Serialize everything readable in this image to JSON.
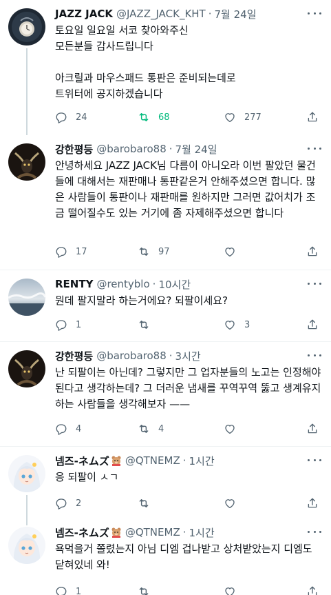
{
  "tweets": [
    {
      "name": "JAZZ JACK",
      "handle": "@JAZZ_JACK_KHT",
      "dot": "·",
      "time": "7월 24일",
      "text": "토요일 일요일 서코 찾아와주신\n모든분들 감사드립니다\n\n아크릴과 마우스패드 통판은 준비되는데로\n트위터에 공지하겠습니다",
      "reply_count": "24",
      "retweet_count": "68",
      "like_count": "277",
      "retweeted": true,
      "avatar": "dark-clock-icon"
    },
    {
      "name": "강한평등",
      "handle": "@barobaro88",
      "dot": "·",
      "time": "7월 24일",
      "text": "안녕하세요 JAZZ JACK님 다름이 아니오라 이번 팔았던 물건들에 대해서는 재판매나 통판같은거 안해주셨으면 합니다. 많은 사람들이 통판이나 재판매를 원하지만 그러면 값어치가 조금 떨어질수도 있는 거기에 좀 자제해주셨으면 합니다",
      "reply_count": "17",
      "retweet_count": "97",
      "like_count": "",
      "retweeted": false,
      "avatar": "dark-horned-figure-icon"
    },
    {
      "name": "RENTY",
      "handle": "@rentyblo",
      "dot": "·",
      "time": "10시간",
      "text": "뭔데 팔지말라 하는거에요? 되팔이세요?",
      "reply_count": "1",
      "retweet_count": "",
      "like_count": "3",
      "retweeted": false,
      "avatar": "sky-landscape-icon"
    },
    {
      "name": "강한평등",
      "handle": "@barobaro88",
      "dot": "·",
      "time": "3시간",
      "text": "난 되팔이는 아닌데? 그렇지만 그 업자분들의 노고는 인정해야된다고 생각하는데? 그 더러운 냄새를 꾸역꾸역 뚫고 생계유지하는 사람들을 생각해보자 ——",
      "reply_count": "4",
      "retweet_count": "4",
      "like_count": "",
      "retweeted": false,
      "avatar": "dark-horned-figure-icon"
    },
    {
      "name": "넴즈-ネムズ",
      "handle": "@QTNEMZ",
      "dot": "·",
      "time": "1시간",
      "text": "응 되팔이 ㅅㄱ",
      "reply_count": "2",
      "retweet_count": "",
      "like_count": "",
      "retweeted": false,
      "avatar": "anime-girl-icon"
    },
    {
      "name": "넴즈-ネムズ",
      "handle": "@QTNEMZ",
      "dot": "·",
      "time": "1시간",
      "text": "욕먹을거 쫄렸는지 아님 디엠 겁나받고 상처받았는지 디엠도 닫혀있네 와!",
      "reply_count": "1",
      "retweet_count": "",
      "like_count": "",
      "retweeted": false,
      "avatar": "anime-girl-icon"
    }
  ]
}
